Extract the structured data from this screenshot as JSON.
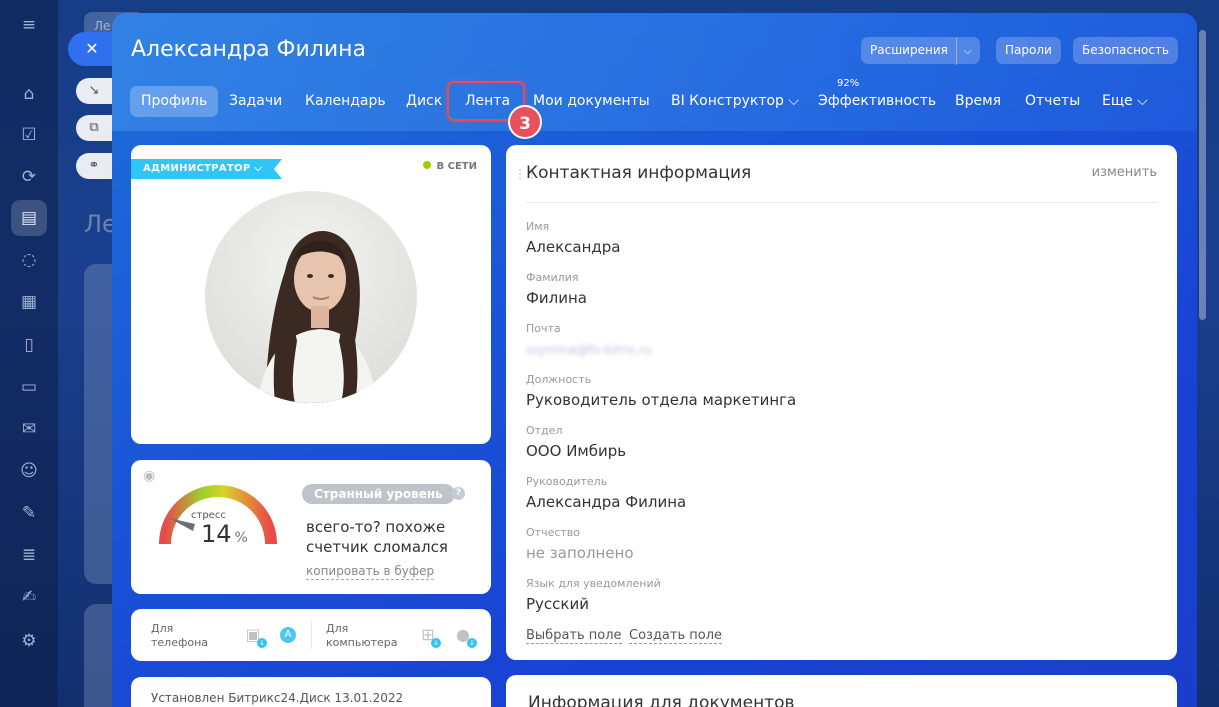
{
  "window": {
    "user_name": "Александра Филина",
    "buttons": {
      "extensions": "Расширения",
      "passwords": "Пароли",
      "security": "Безопасность"
    }
  },
  "tabs": [
    {
      "label": "Профиль",
      "active": true
    },
    {
      "label": "Задачи"
    },
    {
      "label": "Календарь"
    },
    {
      "label": "Диск"
    },
    {
      "label": "Лента",
      "highlighted": true
    },
    {
      "label": "Мои документы"
    },
    {
      "label": "BI Конструктор ⌵"
    },
    {
      "label": "Эффективность",
      "badge": "92%"
    },
    {
      "label": "Время"
    },
    {
      "label": "Отчеты"
    },
    {
      "label": "Еще ⌵"
    }
  ],
  "step_marker": "3",
  "profile": {
    "role_badge": "АДМИНИСТРАТОР",
    "status": "В СЕТИ"
  },
  "stress": {
    "label": "стресс",
    "value": "14",
    "unit": "%",
    "level": "Странный уровень",
    "message": "всего-то? похоже счетчик сломался",
    "copy_link": "копировать в буфер"
  },
  "apps": {
    "phone_label": "Для телефона",
    "computer_label": "Для компьютера"
  },
  "disk_info": "Установлен Битрикс24.Диск 13.01.2022",
  "contact": {
    "title": "Контактная информация",
    "edit": "изменить",
    "fields": [
      {
        "label": "Имя",
        "value": "Александра"
      },
      {
        "label": "Фамилия",
        "value": "Филина"
      },
      {
        "label": "Почта",
        "value": "ssyrnina@fo-bitrix.ru"
      },
      {
        "label": "Должность",
        "value": "Руководитель отдела маркетинга"
      },
      {
        "label": "Отдел",
        "value": "ООО Имбирь"
      },
      {
        "label": "Руководитель",
        "value": "Александра Филина"
      },
      {
        "label": "Отчество",
        "value": "не заполнено"
      },
      {
        "label": "Язык для уведомлений",
        "value": "Русский"
      }
    ],
    "choose_field": "Выбрать поле",
    "create_field": "Создать поле"
  },
  "documents": {
    "title": "Информация для документов"
  },
  "background": {
    "tab_label": "Ле",
    "title": "Ле"
  },
  "colors": {
    "accent": "#2fc6f6",
    "highlight": "#e84a5a",
    "online": "#9dcf00"
  }
}
